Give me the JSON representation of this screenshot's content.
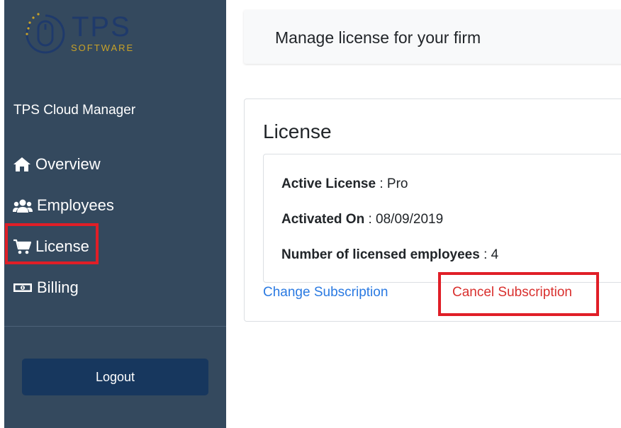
{
  "logo": {
    "brand": "TPS",
    "tagline": "SOFTWARE"
  },
  "sidebar": {
    "app_name": "TPS Cloud Manager",
    "items": [
      {
        "label": "Overview",
        "icon": "home-icon"
      },
      {
        "label": "Employees",
        "icon": "users-icon"
      },
      {
        "label": "License",
        "icon": "cart-icon",
        "highlighted": true
      },
      {
        "label": "Billing",
        "icon": "money-bill-icon"
      }
    ],
    "logout_label": "Logout"
  },
  "header": {
    "title": "Manage license for your firm"
  },
  "license": {
    "title": "License",
    "rows": [
      {
        "label": "Active License",
        "sep": " : ",
        "value": "Pro"
      },
      {
        "label": "Activated On",
        "sep": " : ",
        "value": "08/09/2019"
      },
      {
        "label": "Number of licensed employees",
        "sep": " : ",
        "value": "4"
      }
    ],
    "change_link": "Change Subscription",
    "cancel_link": "Cancel Subscription"
  },
  "colors": {
    "sidebar_bg": "#34495e",
    "logout_bg": "#17375e",
    "link_blue": "#2a7ae2",
    "cancel_red": "#d9302e",
    "highlight_red": "#e01e27"
  }
}
